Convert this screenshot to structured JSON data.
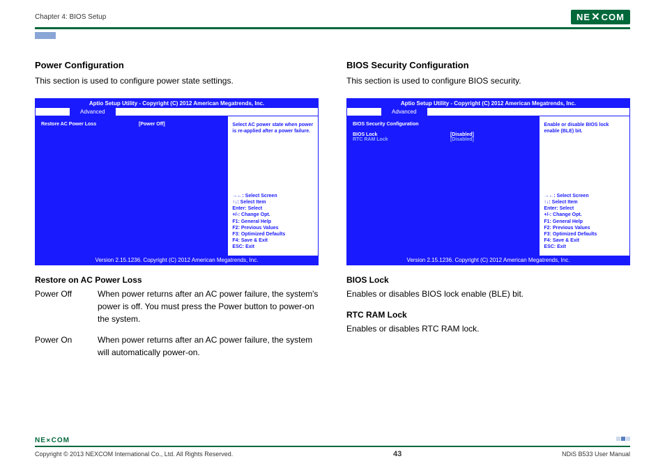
{
  "header": {
    "chapter": "Chapter 4: BIOS Setup",
    "brand": "NEXCOM",
    "brandX": "X"
  },
  "left": {
    "title": "Power Configuration",
    "subtitle": "This section is used to configure power state settings.",
    "bios": {
      "titlebar": "Aptio Setup Utility - Copyright (C) 2012 American Megatrends, Inc.",
      "tab": "Advanced",
      "row1_label": "Restore AC Power Loss",
      "row1_value": "[Power Off]",
      "help": "Select AC power state when power is re-applied after a power failure.",
      "keys": {
        "k1": "→←: Select Screen",
        "k2": "↑↓: Select Item",
        "k3": "Enter: Select",
        "k4": "+/-: Change Opt.",
        "k5": "F1: General Help",
        "k6": "F2: Previous Values",
        "k7": "F3: Optimized Defaults",
        "k8": "F4: Save & Exit",
        "k9": "ESC: Exit"
      },
      "footer": "Version 2.15.1236. Copyright (C) 2012 American Megatrends, Inc."
    },
    "sec_title": "Restore on AC Power Loss",
    "off_term": "Power Off",
    "off_desc": "When power returns after an AC power failure, the system's power is off. You must press the Power button to power-on the system.",
    "on_term": "Power On",
    "on_desc": "When power returns after an AC power failure, the system will automatically power-on."
  },
  "right": {
    "title": "BIOS Security Configuration",
    "subtitle": "This section is used to configure BIOS security.",
    "bios": {
      "titlebar": "Aptio Setup Utility - Copyright (C) 2012 American Megatrends, Inc.",
      "tab": "Advanced",
      "heading": "BIOS Security Configuration",
      "row1_label": "BIOS Lock",
      "row1_value": "[Disabled]",
      "row2_label": "RTC RAM Lock",
      "row2_value": "[Disabled]",
      "help": "Enable or disable BIOS lock enable (BLE) bit.",
      "keys": {
        "k1": "→←: Select Screen",
        "k2": "↑↓: Select Item",
        "k3": "Enter: Select",
        "k4": "+/-: Change Opt.",
        "k5": "F1: General Help",
        "k6": "F2: Previous Values",
        "k7": "F3: Optimized Defaults",
        "k8": "F4: Save & Exit",
        "k9": "ESC: Exit"
      },
      "footer": "Version 2.15.1236. Copyright (C) 2012 American Megatrends, Inc."
    },
    "sec1_title": "BIOS Lock",
    "sec1_desc": "Enables or disables BIOS lock enable (BLE) bit.",
    "sec2_title": "RTC RAM Lock",
    "sec2_desc": "Enables or disables RTC RAM lock."
  },
  "footer": {
    "logo": "NEXCOM",
    "copyright": "Copyright © 2013 NEXCOM International Co., Ltd. All Rights Reserved.",
    "page": "43",
    "doc": "NDiS B533 User Manual"
  }
}
